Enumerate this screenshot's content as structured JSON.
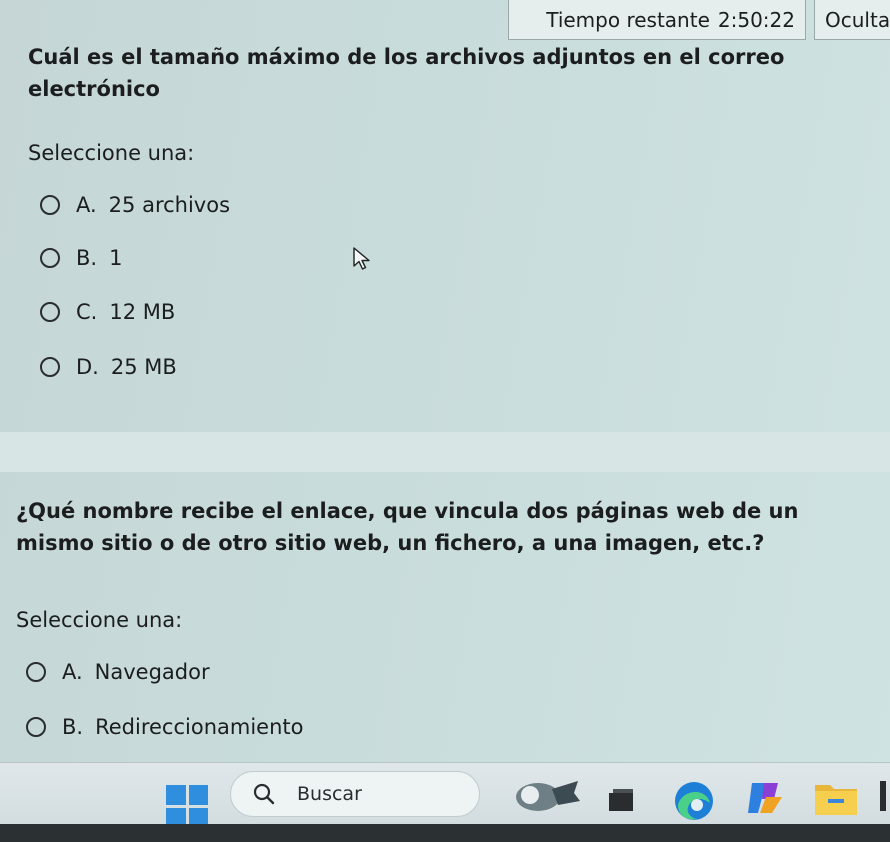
{
  "timer": {
    "label": "Tiempo restante",
    "value": "2:50:22"
  },
  "hide_button": {
    "label": "Oculta"
  },
  "question1": {
    "text_line1": "Cuál es el tamaño máximo de los archivos adjuntos en el correo",
    "text_line2": "electrónico",
    "prompt": "Seleccione una:",
    "options": [
      {
        "letter": "A.",
        "text": "25 archivos"
      },
      {
        "letter": "B.",
        "text": "1"
      },
      {
        "letter": "C.",
        "text": "12 MB"
      },
      {
        "letter": "D.",
        "text": "25 MB"
      }
    ]
  },
  "question2": {
    "text_line1": "¿Qué nombre recibe el enlace, que vincula dos páginas web de un",
    "text_line2": "mismo sitio o de otro sitio web, un fichero, a una imagen, etc.?",
    "prompt": "Seleccione una:",
    "options": [
      {
        "letter": "A.",
        "text": "Navegador"
      },
      {
        "letter": "B.",
        "text": "Redireccionamiento"
      }
    ]
  },
  "taskbar": {
    "search_label": "Buscar",
    "icons": [
      "windows-start-icon",
      "search-icon",
      "weather-widget-icon",
      "task-view-icon",
      "edge-browser-icon",
      "copilot-icon",
      "file-explorer-icon"
    ],
    "accent": "#2f8fde"
  }
}
